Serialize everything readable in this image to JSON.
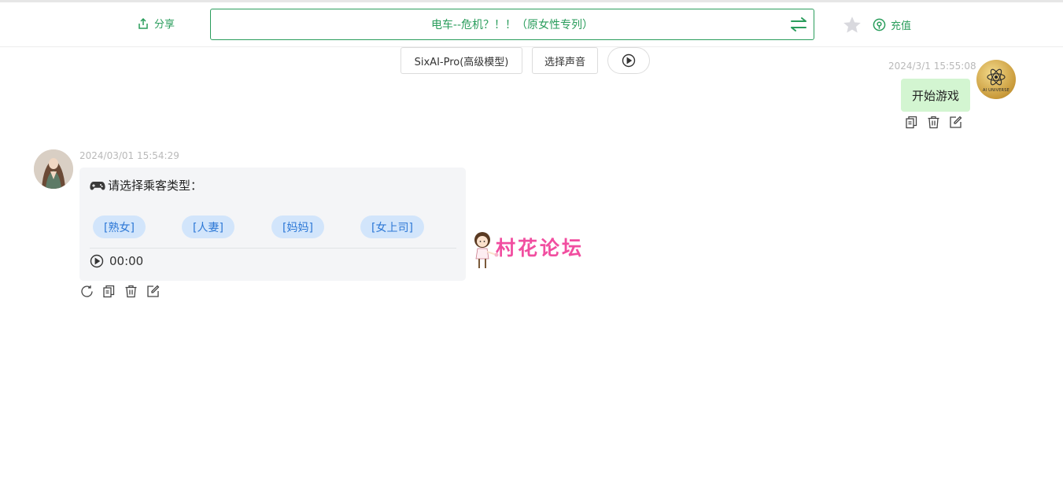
{
  "header": {
    "share_label": "分享",
    "chat_title": "电车--危机？！！（原女性专列）",
    "recharge_label": "充值"
  },
  "toolbar": {
    "model_label": "SixAI-Pro(高级模型)",
    "voice_label": "选择声音"
  },
  "messages": {
    "user": {
      "timestamp": "2024/3/1 15:55:08",
      "text": "开始游戏",
      "avatar_text": "AI UNIVERSE"
    },
    "bot": {
      "timestamp": "2024/03/01 15:54:29",
      "text": "请选择乘客类型：",
      "options": [
        "[熟女]",
        "[人妻]",
        "[妈妈]",
        "[女上司]"
      ],
      "audio_time": "00:00"
    }
  },
  "watermark": {
    "text": "村花论坛"
  },
  "colors": {
    "accent": "#2a9d5c",
    "user_bubble": "#d3f5d1",
    "chip_bg": "#d2e5fb",
    "chip_text": "#2d78d6",
    "watermark": "#f14ea0"
  },
  "icons": [
    "share-icon",
    "swap-icon",
    "star-icon",
    "recharge-icon",
    "play-icon",
    "copy-icon",
    "delete-icon",
    "edit-icon",
    "refresh-icon",
    "gamepad-icon"
  ]
}
